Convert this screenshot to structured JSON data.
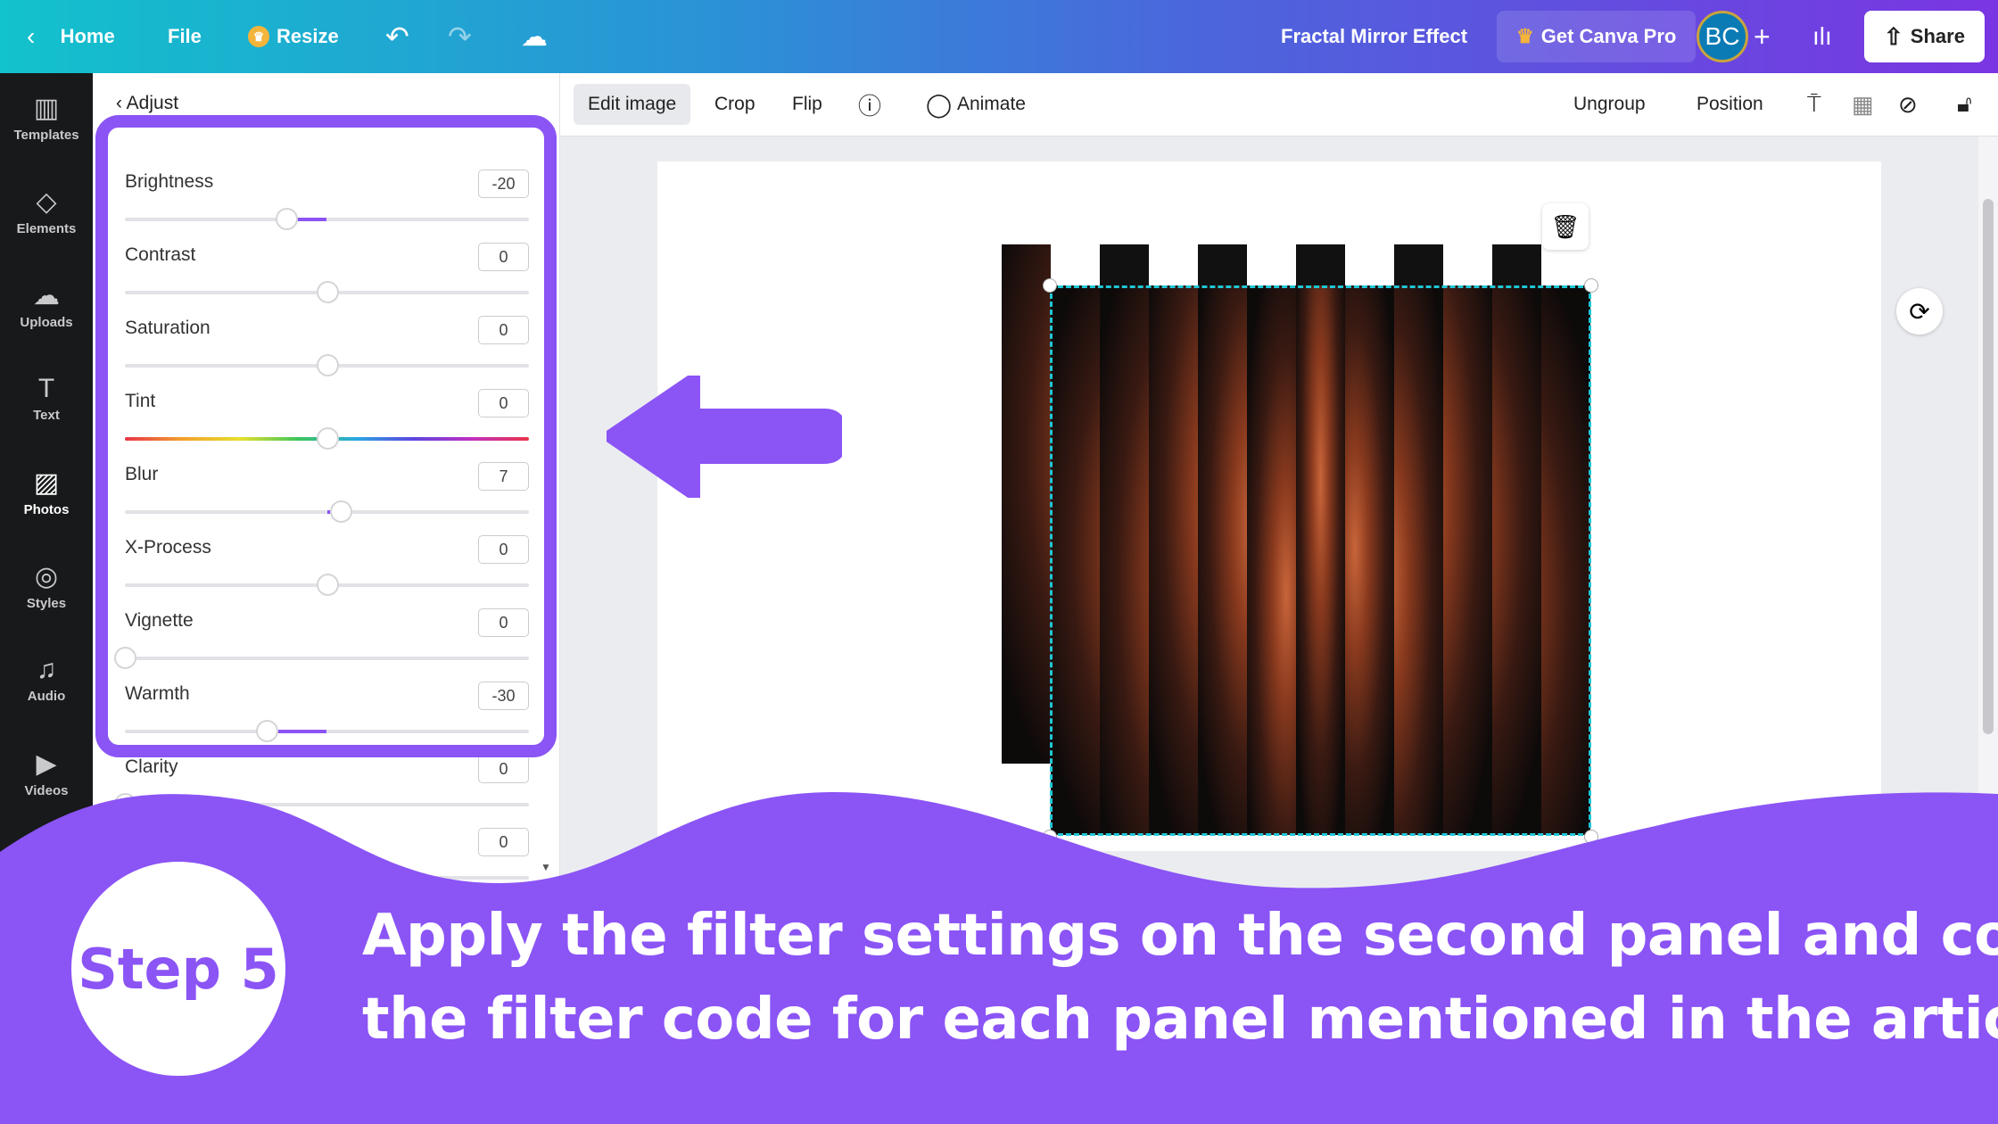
{
  "topbar": {
    "home": "Home",
    "file": "File",
    "resize": "Resize",
    "title": "Fractal Mirror Effect",
    "get_pro": "Get Canva Pro",
    "avatar": "BC",
    "add": "+",
    "share": "Share"
  },
  "sidebar": {
    "items": [
      {
        "label": "Templates",
        "icon": "▥"
      },
      {
        "label": "Elements",
        "icon": "◇"
      },
      {
        "label": "Uploads",
        "icon": "☁"
      },
      {
        "label": "Text",
        "icon": "T"
      },
      {
        "label": "Photos",
        "icon": "▨"
      },
      {
        "label": "Styles",
        "icon": "◎"
      },
      {
        "label": "Audio",
        "icon": "♫"
      },
      {
        "label": "Videos",
        "icon": "▶"
      }
    ],
    "active": "Photos"
  },
  "panel": {
    "back_label": "Adjust",
    "sliders": [
      {
        "label": "Brightness",
        "value": "-20",
        "min": -100
      },
      {
        "label": "Contrast",
        "value": "0",
        "min": -100
      },
      {
        "label": "Saturation",
        "value": "0",
        "min": -100
      },
      {
        "label": "Tint",
        "value": "0",
        "min": -100
      },
      {
        "label": "Blur",
        "value": "7",
        "min": -100
      },
      {
        "label": "X-Process",
        "value": "0",
        "min": -100
      },
      {
        "label": "Vignette",
        "value": "0",
        "min": 0
      },
      {
        "label": "Warmth",
        "value": "-30",
        "min": -100
      },
      {
        "label": "Clarity",
        "value": "0",
        "min": 0
      },
      {
        "label": "",
        "value": "0",
        "min": -100
      }
    ]
  },
  "toolbar": {
    "edit_image": "Edit image",
    "crop": "Crop",
    "flip": "Flip",
    "animate": "Animate",
    "ungroup": "Ungroup",
    "position": "Position"
  },
  "overlay": {
    "step": "Step 5",
    "line1": "Apply the filter settings on the second panel and copy",
    "line2": "the filter code for each panel mentioned in the article.",
    "accent": "#8b54f5"
  }
}
